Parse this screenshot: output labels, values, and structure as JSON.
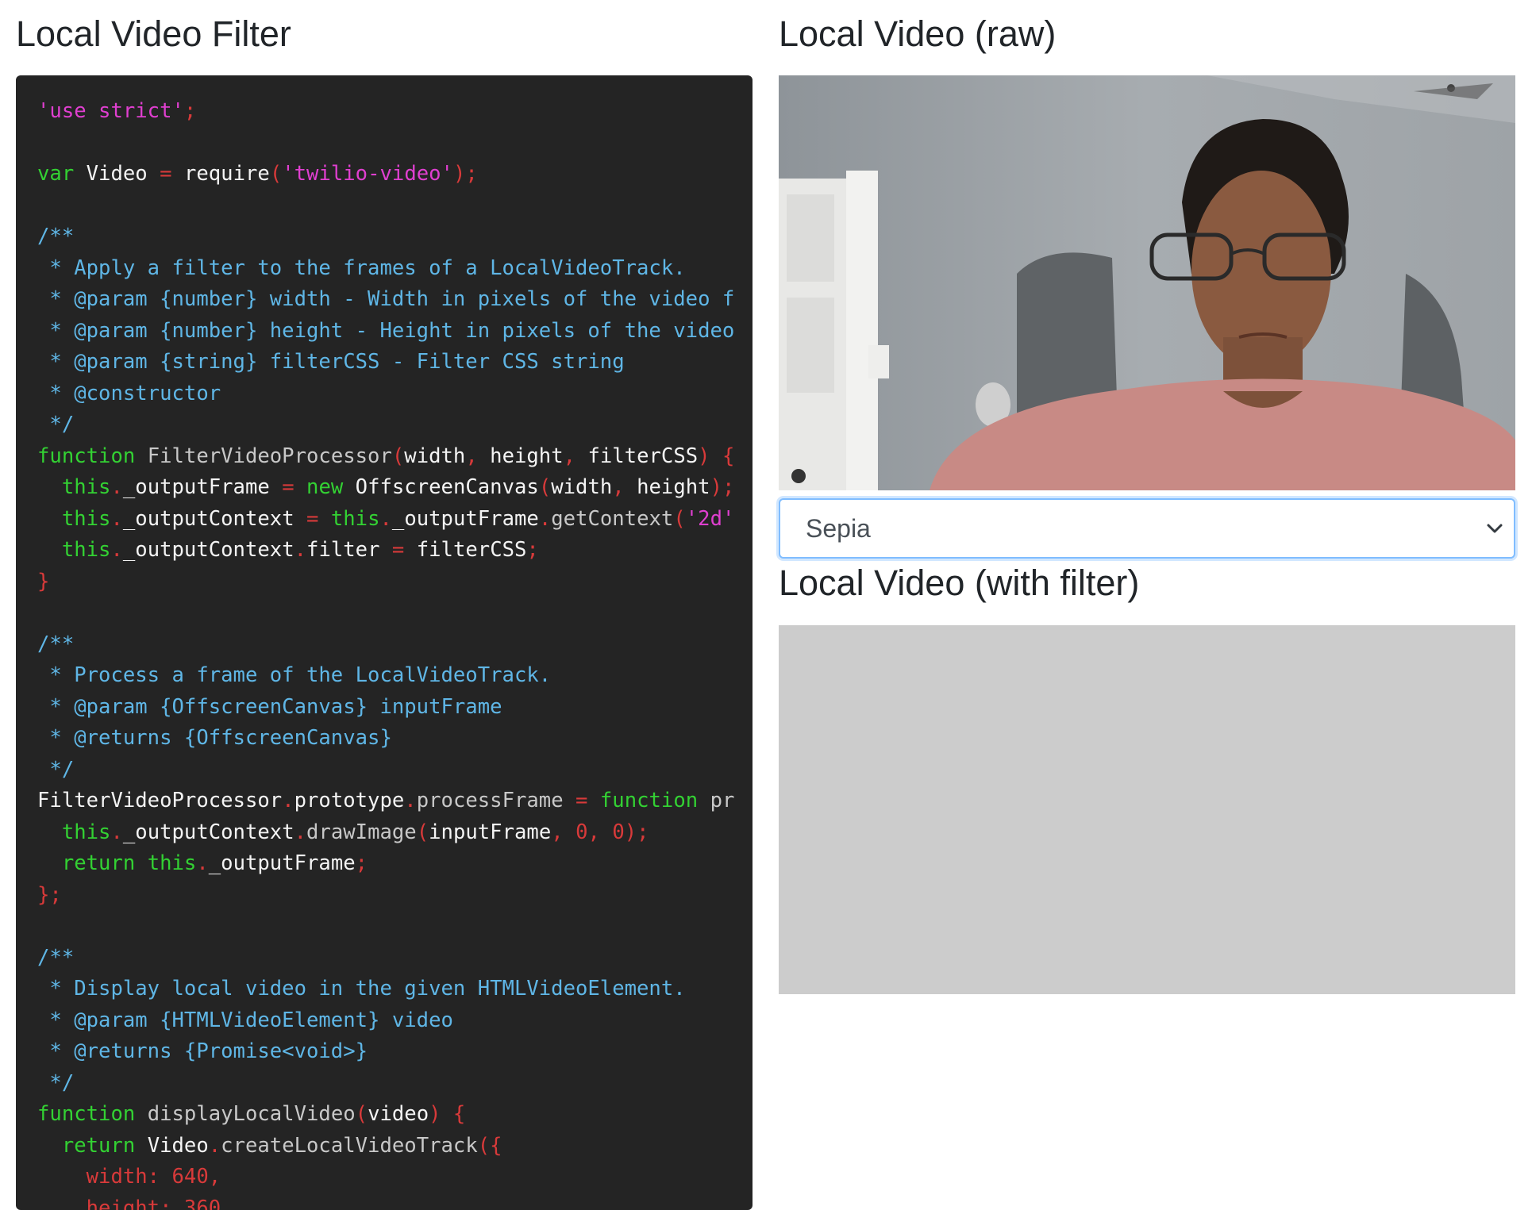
{
  "page": {
    "title_left": "Local Video Filter",
    "title_raw": "Local Video (raw)",
    "title_filtered": "Local Video (with filter)"
  },
  "filter_select": {
    "selected": "Sepia"
  },
  "code": {
    "lines": [
      [
        [
          "str",
          "'use strict'"
        ],
        [
          "pu",
          ";"
        ]
      ],
      [],
      [
        [
          "kw",
          "var"
        ],
        [
          "id",
          " Video "
        ],
        [
          "pu",
          "="
        ],
        [
          "id",
          " require"
        ],
        [
          "pu",
          "("
        ],
        [
          "str",
          "'twilio-video'"
        ],
        [
          "pu",
          ");"
        ]
      ],
      [],
      [
        [
          "cm",
          "/**"
        ]
      ],
      [
        [
          "cm",
          " * Apply a filter to the frames of a LocalVideoTrack."
        ]
      ],
      [
        [
          "cm",
          " * @param {number} width - Width in pixels of the video f"
        ]
      ],
      [
        [
          "cm",
          " * @param {number} height - Height in pixels of the video"
        ]
      ],
      [
        [
          "cm",
          " * @param {string} filterCSS - Filter CSS string"
        ]
      ],
      [
        [
          "cm",
          " * @constructor"
        ]
      ],
      [
        [
          "cm",
          " */"
        ]
      ],
      [
        [
          "kw",
          "function"
        ],
        [
          "fn",
          " FilterVideoProcessor"
        ],
        [
          "pu",
          "("
        ],
        [
          "id",
          "width"
        ],
        [
          "pu",
          ", "
        ],
        [
          "id",
          "height"
        ],
        [
          "pu",
          ", "
        ],
        [
          "id",
          "filterCSS"
        ],
        [
          "pu",
          ") {"
        ]
      ],
      [
        [
          "kw",
          "  this"
        ],
        [
          "pu",
          "."
        ],
        [
          "id",
          "_outputFrame "
        ],
        [
          "pu",
          "="
        ],
        [
          "kw",
          " new"
        ],
        [
          "id",
          " OffscreenCanvas"
        ],
        [
          "pu",
          "("
        ],
        [
          "id",
          "width"
        ],
        [
          "pu",
          ", "
        ],
        [
          "id",
          "height"
        ],
        [
          "pu",
          ");"
        ]
      ],
      [
        [
          "kw",
          "  this"
        ],
        [
          "pu",
          "."
        ],
        [
          "id",
          "_outputContext "
        ],
        [
          "pu",
          "="
        ],
        [
          "kw",
          " this"
        ],
        [
          "pu",
          "."
        ],
        [
          "id",
          "_outputFrame"
        ],
        [
          "pu",
          "."
        ],
        [
          "fn",
          "getContext"
        ],
        [
          "pu",
          "("
        ],
        [
          "str",
          "'2d'"
        ]
      ],
      [
        [
          "kw",
          "  this"
        ],
        [
          "pu",
          "."
        ],
        [
          "id",
          "_outputContext"
        ],
        [
          "pu",
          "."
        ],
        [
          "id",
          "filter "
        ],
        [
          "pu",
          "="
        ],
        [
          "id",
          " filterCSS"
        ],
        [
          "pu",
          ";"
        ]
      ],
      [
        [
          "pu",
          "}"
        ]
      ],
      [],
      [
        [
          "cm",
          "/**"
        ]
      ],
      [
        [
          "cm",
          " * Process a frame of the LocalVideoTrack."
        ]
      ],
      [
        [
          "cm",
          " * @param {OffscreenCanvas} inputFrame"
        ]
      ],
      [
        [
          "cm",
          " * @returns {OffscreenCanvas}"
        ]
      ],
      [
        [
          "cm",
          " */"
        ]
      ],
      [
        [
          "id",
          "FilterVideoProcessor"
        ],
        [
          "pu",
          "."
        ],
        [
          "id",
          "prototype"
        ],
        [
          "pu",
          "."
        ],
        [
          "fn",
          "processFrame "
        ],
        [
          "pu",
          "="
        ],
        [
          "kw",
          " function"
        ],
        [
          "fn",
          " pr"
        ]
      ],
      [
        [
          "kw",
          "  this"
        ],
        [
          "pu",
          "."
        ],
        [
          "id",
          "_outputContext"
        ],
        [
          "pu",
          "."
        ],
        [
          "fn",
          "drawImage"
        ],
        [
          "pu",
          "("
        ],
        [
          "id",
          "inputFrame"
        ],
        [
          "pu",
          ", "
        ],
        [
          "nm",
          "0"
        ],
        [
          "pu",
          ", "
        ],
        [
          "nm",
          "0"
        ],
        [
          "pu",
          ");"
        ]
      ],
      [
        [
          "kw",
          "  return"
        ],
        [
          "kw",
          " this"
        ],
        [
          "pu",
          "."
        ],
        [
          "id",
          "_outputFrame"
        ],
        [
          "pu",
          ";"
        ]
      ],
      [
        [
          "pu",
          "};"
        ]
      ],
      [],
      [
        [
          "cm",
          "/**"
        ]
      ],
      [
        [
          "cm",
          " * Display local video in the given HTMLVideoElement."
        ]
      ],
      [
        [
          "cm",
          " * @param {HTMLVideoElement} video"
        ]
      ],
      [
        [
          "cm",
          " * @returns {Promise<void>}"
        ]
      ],
      [
        [
          "cm",
          " */"
        ]
      ],
      [
        [
          "kw",
          "function"
        ],
        [
          "fn",
          " displayLocalVideo"
        ],
        [
          "pu",
          "("
        ],
        [
          "id",
          "video"
        ],
        [
          "pu",
          ") {"
        ]
      ],
      [
        [
          "kw",
          "  return"
        ],
        [
          "id",
          " Video"
        ],
        [
          "pu",
          "."
        ],
        [
          "fn",
          "createLocalVideoTrack"
        ],
        [
          "pu",
          "({"
        ]
      ],
      [
        [
          "nm",
          "    width: 640,"
        ]
      ],
      [
        [
          "nm",
          "    height: 360"
        ]
      ]
    ]
  },
  "colors": {
    "code_bg": "#242424",
    "string": "#e03fd0",
    "keyword": "#33d133",
    "comment": "#5fb6e6",
    "punctuation": "#d83a3a",
    "filtered_placeholder": "#cccccc",
    "select_focus": "#80bdff"
  },
  "icons": {
    "select_chevron": "chevron-down-icon"
  }
}
